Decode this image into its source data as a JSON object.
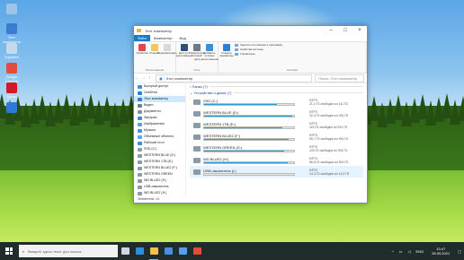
{
  "desktop": {
    "icons": [
      {
        "label": "",
        "icon": "recycle-bin-icon",
        "color": "#9fc4e8"
      },
      {
        "label": "Этот компьютер",
        "icon": "computer-icon",
        "color": "#3b7bd1"
      },
      {
        "label": "Корзина",
        "icon": "trash-icon",
        "color": "#c8d8e8"
      },
      {
        "label": "Google Chrome",
        "icon": "chrome-icon",
        "color": "#e54b3c"
      },
      {
        "label": "Opera",
        "icon": "opera-icon",
        "color": "#d01a2a"
      },
      {
        "label": "",
        "icon": "app-icon",
        "color": "#2a7ad6"
      }
    ]
  },
  "window": {
    "title": "Этот компьютер",
    "ribbon_tabs": [
      "Файл",
      "Компьютер",
      "Вид"
    ],
    "ribbon": {
      "location_buttons": [
        "Свойства",
        "Открыть",
        "Переименовать"
      ],
      "location_label": "Расположение",
      "network_buttons": [
        "Доступ к мультимедиа",
        "Подключить сетевой диск",
        "Добавить сетевое расположение"
      ],
      "network_label": "Сеть",
      "open_settings": "Открыть параметры",
      "system_items": [
        "Удалить или изменить программу",
        "Свойства системы",
        "Управление"
      ],
      "system_label": "Система"
    },
    "address": {
      "path": "Этот компьютер",
      "search_placeholder": "Поиск: Этот компьютер"
    },
    "nav_items": [
      {
        "label": "Быстрый доступ",
        "color": "#3b8de0"
      },
      {
        "label": "OneDrive",
        "color": "#2f7dd6"
      },
      {
        "label": "Этот компьютер",
        "color": "#3b7bd1",
        "selected": true
      },
      {
        "label": "Видео",
        "color": "#6b7d91"
      },
      {
        "label": "Документы",
        "color": "#7c8fa3"
      },
      {
        "label": "Загрузки",
        "color": "#3a8ad8"
      },
      {
        "label": "Изображения",
        "color": "#5aa0d8"
      },
      {
        "label": "Музыка",
        "color": "#4a90d9"
      },
      {
        "label": "Объемные объекты",
        "color": "#6aa6d8"
      },
      {
        "label": "Рабочий стол",
        "color": "#3f8bd5"
      },
      {
        "label": "SSD (C:)",
        "color": "#8a9aa8"
      },
      {
        "label": "WESTERN BLUE (D:)",
        "color": "#8a9aa8"
      },
      {
        "label": "WESTERN 1TB (E:)",
        "color": "#8a9aa8"
      },
      {
        "label": "WESTERN BLUE2 (F:)",
        "color": "#8a9aa8"
      },
      {
        "label": "WESTERN GREEN",
        "color": "#8a9aa8"
      },
      {
        "label": "WD BLUE2 (H:)",
        "color": "#8a9aa8"
      },
      {
        "label": "USB-накопитель",
        "color": "#8a9aa8"
      },
      {
        "label": "WD BLUE2 (H:)",
        "color": "#8a9aa8"
      },
      {
        "label": "Сеть",
        "color": "#4a86c8"
      }
    ],
    "sections": {
      "folders": "Папки (7)",
      "devices": "Устройства и диски (7)"
    },
    "drives": [
      {
        "name": "SSD (C:)",
        "fs": "NTFS",
        "free": "21,1 ГБ свободно из 111 ГБ",
        "used": 0.81
      },
      {
        "name": "WESTERN BLUE (D:)",
        "fs": "NTFS",
        "free": "22,3 ГБ свободно из 931 ГБ",
        "used": 0.98
      },
      {
        "name": "WESTERN 1TB (E:)",
        "fs": "NTFS",
        "free": "119 ГБ свободно из 931 ГБ",
        "used": 0.87
      },
      {
        "name": "WESTERN BLUE2 (F:)",
        "fs": "NTFS",
        "free": "55,7 ГБ свободно из 931 ГБ",
        "used": 0.94
      },
      {
        "name": "WESTERN GREEN (G:)",
        "fs": "NTFS",
        "free": "103 ГБ свободно из 931 ГБ",
        "used": 0.89
      },
      {
        "name": "WD BLUE2 (H:)",
        "fs": "NTFS",
        "free": "68,5 ГБ свободно из 931 ГБ",
        "used": 0.93
      },
      {
        "name": "USB-накопитель (I:)",
        "fs": "NTFS",
        "free": "14,3 ГБ свободно из 14,3 ГБ",
        "used": 0.0,
        "selected": true
      }
    ],
    "status": "Элементов: 14"
  },
  "taskbar": {
    "search_placeholder": "Введите здесь текст для поиска",
    "apps": [
      {
        "icon": "task-view-icon",
        "color": "#cfd8e2"
      },
      {
        "icon": "edge-icon",
        "color": "#2d8fe0"
      },
      {
        "icon": "explorer-icon",
        "color": "#f2c04a",
        "active": true
      },
      {
        "icon": "store-icon",
        "color": "#4a8fe0"
      },
      {
        "icon": "mail-icon",
        "color": "#5aa0e8"
      },
      {
        "icon": "chrome-icon",
        "color": "#e54b3c"
      }
    ],
    "lang": "ENG",
    "time": "13:47",
    "date": "28.09.2021"
  }
}
